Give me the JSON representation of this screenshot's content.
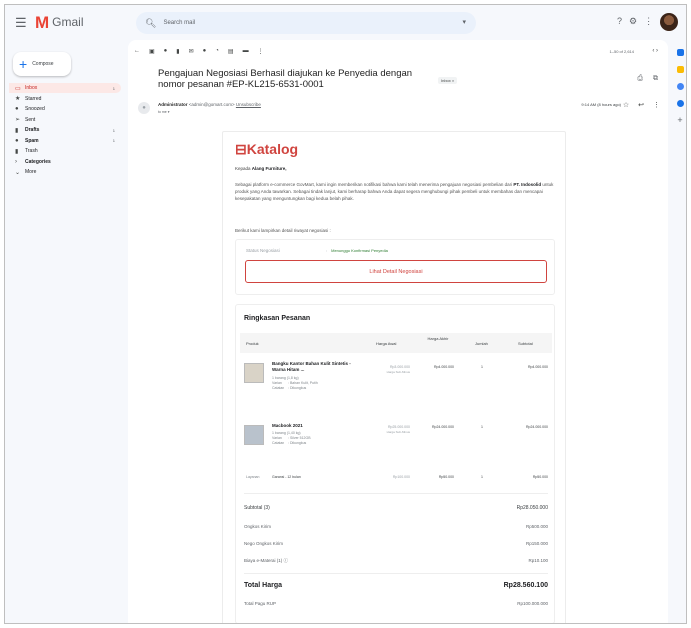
{
  "app": {
    "logo_text": "Gmail",
    "search_placeholder": "Search mail"
  },
  "compose": {
    "label": "Compose"
  },
  "sidebar": {
    "items": [
      {
        "label": "Inbox",
        "icon": "inbox-icon",
        "count": "1",
        "active": true
      },
      {
        "label": "Starred",
        "icon": "star-icon",
        "count": ""
      },
      {
        "label": "Snoozed",
        "icon": "clock-icon",
        "count": ""
      },
      {
        "label": "Sent",
        "icon": "send-icon",
        "count": ""
      },
      {
        "label": "Drafts",
        "icon": "draft-icon",
        "count": "1"
      },
      {
        "label": "Spam",
        "icon": "spam-icon",
        "count": "1"
      },
      {
        "label": "Trash",
        "icon": "trash-icon",
        "count": ""
      },
      {
        "label": "Categories",
        "icon": "label-icon",
        "count": ""
      },
      {
        "label": "More",
        "icon": "chevron-down-icon",
        "count": ""
      }
    ]
  },
  "toolbar": {
    "pager": "1–50 of 2,614"
  },
  "email": {
    "subject": "Pengajuan Negosiasi Berhasil diajukan ke Penyedia dengan nomor pesanan #EP-KL215-6531-0001",
    "label": "Inbox ×",
    "sender_name": "Administrator",
    "sender_email": "<admin@gomart.com>",
    "unsubscribe": "Unsubscribe",
    "to": "to me ▾",
    "time": "9:14 AM (8 hours ago)"
  },
  "body": {
    "brand": "Katalog",
    "greeting_prefix": "Kepada",
    "greeting_name": "Alang Furniture,",
    "intro_1": "Sebagai platform e-commerce GovMart, kami ingin memberikan notifikasi bahwa kami telah menerima pengajuan negosiasi pembelian dari ",
    "intro_company": "PT. Indosolid",
    "intro_2": " untuk produk yang Anda tawarkan. Sebagai tindak lanjut, kami berharap bahwa Anda dapat segera menghubungi pihak pembeli untuk membahas dan mencapai kesepakatan yang menguntungkan bagi kedua belah pihak.",
    "detail_intro": "Berikut kami lampirkan detail riwayat negosiasi :",
    "status_label": "Status Negosiasi",
    "status_value": "Menunggu Konfirmasi Penyedia",
    "detail_button": "Lihat Detail Negosiasi",
    "summary_title": "Ringkasan Pesanan",
    "columns": {
      "product": "Produk",
      "price": "Harga Awal",
      "final_price": "Harga Akhir",
      "qty": "Jumlah",
      "subtotal": "Subtotal"
    },
    "products": [
      {
        "name": "Bangku Kantor Bahan Kulit Sintetis - Warna Hitam ...",
        "meta1": "1 barang (1,8 kg)",
        "meta2_key": "Varian",
        "meta2_val": ": Bahan Kulit, Putih",
        "meta3_key": "Catatan",
        "meta3_val": ": Dikungkus",
        "price": "Rp3.000.000",
        "price_note": "Harga Sub-Minus",
        "final": "Rp4.000.000",
        "qty": "1",
        "subtotal": "Rp4.000.000"
      },
      {
        "name": "Macbook 2021",
        "meta1": "1 barang (1,40 kg)",
        "meta2_key": "Varian",
        "meta2_val": ": Silver 512GB",
        "meta3_key": "Catatan",
        "meta3_val": ": Dikungkus",
        "price": "Rp25.000.000",
        "price_note": "Harga Sub-Minus",
        "final": "Rp24.000.000",
        "qty": "1",
        "subtotal": "Rp24.000.000"
      }
    ],
    "addon": {
      "label": "Layanan",
      "name": "Garansi - 12 bulan",
      "price": "Rp100.000",
      "final": "Rp50.000",
      "qty": "1",
      "subtotal": "Rp50.000"
    },
    "totals": [
      {
        "label": "Subtotal (3)",
        "value": "Rp28.050.000",
        "style": "sub1"
      },
      {
        "label": "Ongkos Kirim",
        "value": "Rp500.000",
        "style": ""
      },
      {
        "label": "Nego Ongkos Kirim",
        "value": "Rp150.000",
        "style": ""
      },
      {
        "label": "Biaya e-Materai (1) ⓘ",
        "value": "Rp10.100",
        "style": ""
      },
      {
        "label": "Total Harga",
        "value": "Rp28.560.100",
        "style": "big"
      },
      {
        "label": "Total Pagu RUP",
        "value": "Rp100.000.000",
        "style": ""
      }
    ]
  },
  "colors": {
    "brand": "#d0443f",
    "active_nav": "#fce8e6",
    "status_green": "#2e7d32"
  }
}
